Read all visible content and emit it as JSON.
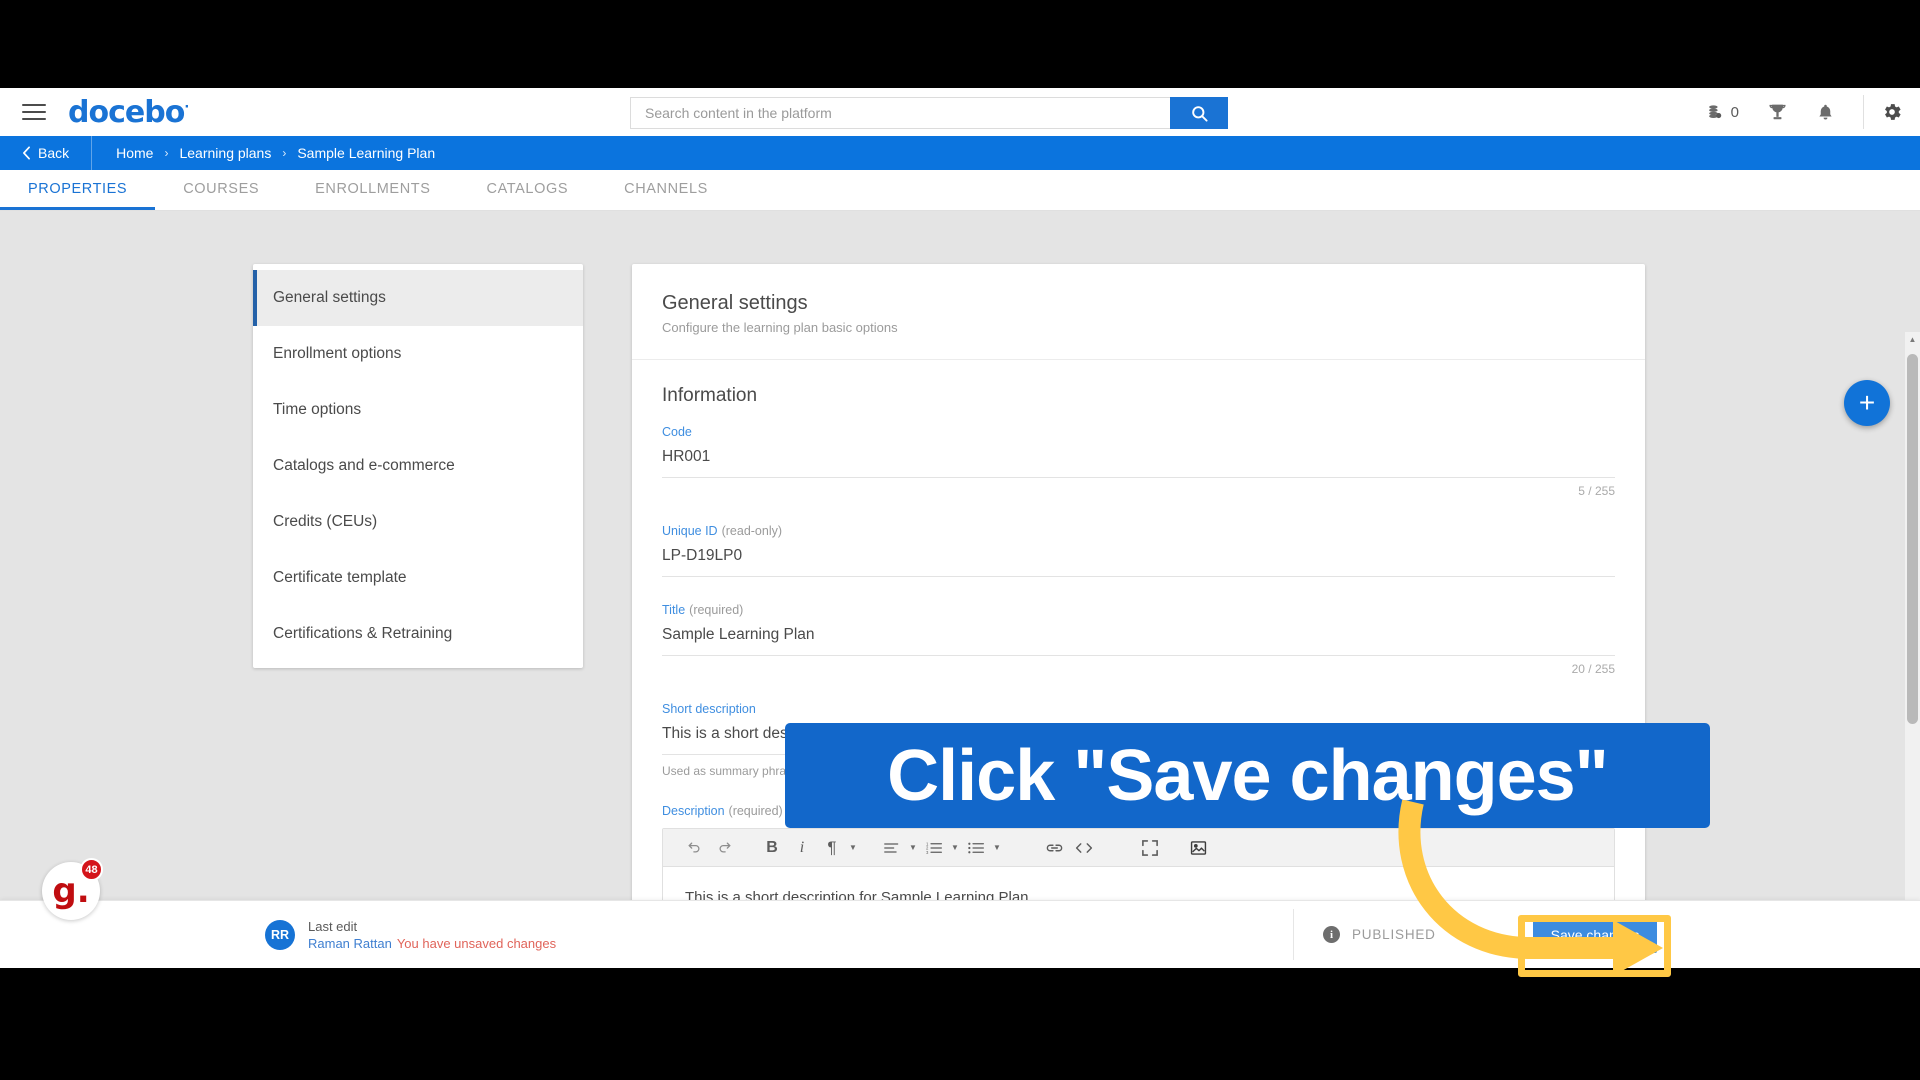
{
  "topbar": {
    "menu_icon": "hamburger-icon",
    "brand": "docebo",
    "brand_mark": "·",
    "search": {
      "placeholder": "Search content in the platform",
      "value": "",
      "button_icon": "search-icon"
    },
    "coins": {
      "icon": "coins-icon",
      "count": "0"
    },
    "trophy_icon": "trophy-icon",
    "bell_icon": "bell-icon",
    "gear_icon": "gear-icon"
  },
  "breadcrumb": {
    "back_label": "Back",
    "back_icon": "chevron-left-icon",
    "separator": "›",
    "items": [
      {
        "label": "Home"
      },
      {
        "label": "Learning plans"
      },
      {
        "label": "Sample Learning Plan"
      }
    ]
  },
  "tabs": [
    {
      "label": "PROPERTIES",
      "active": true
    },
    {
      "label": "COURSES",
      "active": false
    },
    {
      "label": "ENROLLMENTS",
      "active": false
    },
    {
      "label": "CATALOGS",
      "active": false
    },
    {
      "label": "CHANNELS",
      "active": false
    }
  ],
  "sidebar": {
    "items": [
      {
        "label": "General settings",
        "active": true
      },
      {
        "label": "Enrollment options",
        "active": false
      },
      {
        "label": "Time options",
        "active": false
      },
      {
        "label": "Catalogs and e-commerce",
        "active": false
      },
      {
        "label": "Credits (CEUs)",
        "active": false
      },
      {
        "label": "Certificate template",
        "active": false
      },
      {
        "label": "Certifications & Retraining",
        "active": false
      }
    ]
  },
  "main": {
    "title": "General settings",
    "subtitle": "Configure the learning plan basic options",
    "section_title": "Information",
    "fields": {
      "code": {
        "label": "Code",
        "value": "HR001",
        "counter": "5 / 255"
      },
      "unique_id": {
        "label": "Unique ID",
        "modifier": "(read-only)",
        "value": "LP-D19LP0"
      },
      "title": {
        "label": "Title",
        "modifier": "(required)",
        "value": "Sample Learning Plan",
        "counter": "20 / 255"
      },
      "short_description": {
        "label": "Short description",
        "value": "This is a short description for Sample Learning Plan",
        "hint": "Used as summary phrase"
      },
      "description": {
        "label": "Description",
        "modifier": "(required)",
        "body": "This is a short description for Sample Learning Plan"
      }
    },
    "editor_toolbar": [
      {
        "icon": "undo-icon",
        "glyph": "↶",
        "caret": false
      },
      {
        "icon": "redo-icon",
        "glyph": "↷",
        "caret": false
      },
      {
        "icon": "bold-icon",
        "glyph": "B",
        "caret": false
      },
      {
        "icon": "italic-icon",
        "glyph": "i",
        "caret": false
      },
      {
        "icon": "paragraph-format-icon",
        "glyph": "¶",
        "caret": true
      },
      {
        "icon": "align-left-icon",
        "glyph": "≡",
        "caret": true
      },
      {
        "icon": "ordered-list-icon",
        "glyph": "≣",
        "caret": true
      },
      {
        "icon": "unordered-list-icon",
        "glyph": "≣",
        "caret": true
      },
      {
        "icon": "insert-link-icon",
        "glyph": "⚭",
        "caret": false
      },
      {
        "icon": "code-view-icon",
        "glyph": "‹›",
        "caret": false
      },
      {
        "icon": "fullscreen-icon",
        "glyph": "⛶",
        "caret": false
      },
      {
        "icon": "insert-image-icon",
        "glyph": "❑",
        "caret": false
      }
    ]
  },
  "fab": {
    "icon": "plus-icon",
    "glyph": "+"
  },
  "scrollbar": {
    "up_glyph": "▲",
    "down_glyph": "▼"
  },
  "bottombar": {
    "avatar_initials": "RR",
    "last_edit_label": "Last edit",
    "editor_name": "Raman Rattan",
    "unsaved_warning": "You have unsaved changes",
    "info_icon": "info-icon",
    "info_glyph": "i",
    "status": "PUBLISHED",
    "save_label": "Save changes"
  },
  "annotation": {
    "banner_text": "Click \"Save changes\"",
    "arrow_icon": "curved-arrow-icon",
    "highlight_target": "save-changes-button"
  },
  "widget": {
    "logo_letter": "g",
    "logo_dot": ".",
    "badge_count": "48"
  },
  "colors": {
    "brand_blue": "#1a73d4",
    "bar_blue": "#0b74de",
    "accent_yellow": "#ffc845",
    "warning_red": "#e0645a",
    "logo_red": "#c00d10"
  }
}
